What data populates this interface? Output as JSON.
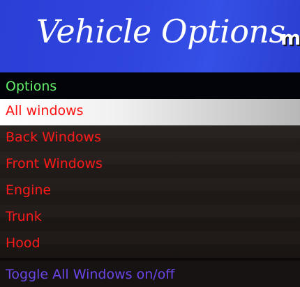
{
  "banner": {
    "title": "Vehicle Options",
    "logo_text": "m"
  },
  "subheader": {
    "label": "Options"
  },
  "menu": {
    "items": [
      {
        "label": "All windows",
        "selected": true
      },
      {
        "label": "Back Windows",
        "selected": false
      },
      {
        "label": "Front Windows",
        "selected": false
      },
      {
        "label": "Engine",
        "selected": false
      },
      {
        "label": "Trunk",
        "selected": false
      },
      {
        "label": "Hood",
        "selected": false
      }
    ]
  },
  "footer": {
    "description": "Toggle All Windows on/off"
  },
  "colors": {
    "banner": "#2f45de",
    "subheader_text": "#63f06a",
    "item_text": "#ff1a1a",
    "footer_text": "#6b45e8",
    "selected_bg": "#ffffff"
  }
}
